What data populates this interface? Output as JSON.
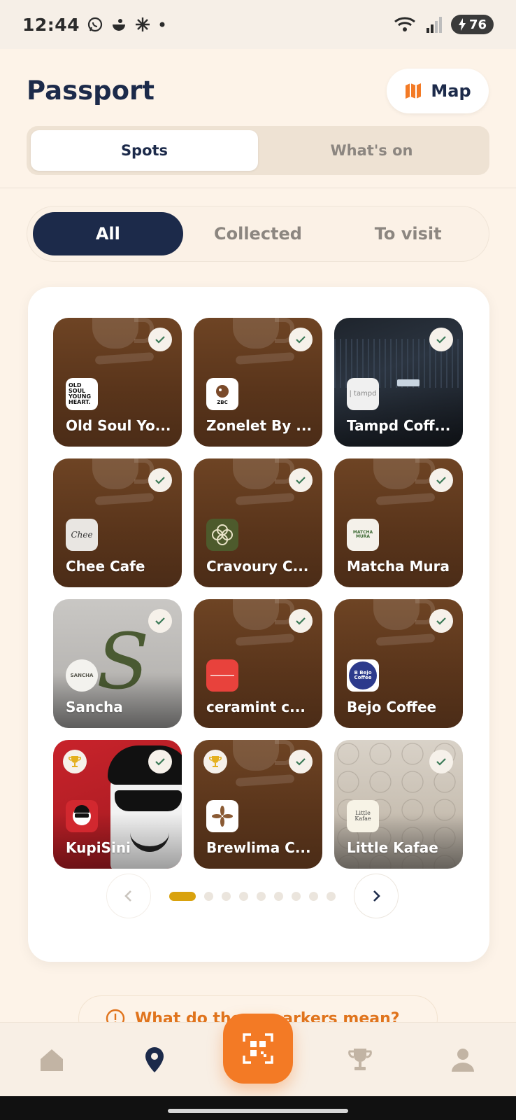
{
  "status_bar": {
    "time": "12:44",
    "battery": "76",
    "notification_icons": [
      "whatsapp-icon",
      "app-icon",
      "pinwheel-icon",
      "dot-icon"
    ]
  },
  "header": {
    "title": "Passport",
    "map_button_label": "Map"
  },
  "tabs": [
    {
      "label": "Spots",
      "active": true
    },
    {
      "label": "What's on",
      "active": false
    }
  ],
  "filters": [
    {
      "label": "All",
      "active": true
    },
    {
      "label": "Collected",
      "active": false
    },
    {
      "label": "To visit",
      "active": false
    }
  ],
  "spots": [
    {
      "name": "Old Soul Yo...",
      "logo_text": "OLD SOUL YOUNG HEART.",
      "collected": true,
      "trophy": false
    },
    {
      "name": "Zonelet By ...",
      "logo_text": "ZBC",
      "collected": true,
      "trophy": false
    },
    {
      "name": "Tampd Coff...",
      "logo_text": "| tampd",
      "collected": true,
      "trophy": false
    },
    {
      "name": "Chee Cafe",
      "logo_text": "Chee",
      "collected": true,
      "trophy": false
    },
    {
      "name": "Cravoury C...",
      "logo_text": "",
      "collected": true,
      "trophy": false
    },
    {
      "name": "Matcha Mura",
      "logo_text": "MATCHA MURA",
      "collected": true,
      "trophy": false
    },
    {
      "name": "Sancha",
      "logo_text": "SANCHA",
      "collected": true,
      "trophy": false
    },
    {
      "name": "ceramint c...",
      "logo_text": "",
      "collected": true,
      "trophy": false
    },
    {
      "name": "Bejo Coffee",
      "logo_text": "B Bejo Coffee",
      "collected": true,
      "trophy": false
    },
    {
      "name": "KupiSini",
      "logo_text": "",
      "collected": true,
      "trophy": true
    },
    {
      "name": "Brewlima C...",
      "logo_text": "",
      "collected": true,
      "trophy": true
    },
    {
      "name": "Little Kafae",
      "logo_text": "Little Kafae",
      "collected": true,
      "trophy": false
    }
  ],
  "pagination": {
    "total_pages": 9,
    "current_page": 1
  },
  "legend_prompt": "What do these markers mean?",
  "bottom_nav": [
    {
      "label": "home",
      "icon": "home-icon",
      "active": false
    },
    {
      "label": "passport",
      "icon": "location-pin-icon",
      "active": true
    },
    {
      "label": "scan",
      "icon": "qr-scan-icon",
      "active": false
    },
    {
      "label": "rewards",
      "icon": "trophy-icon",
      "active": false
    },
    {
      "label": "profile",
      "icon": "person-icon",
      "active": false
    }
  ],
  "colors": {
    "navy": "#1c2a4a",
    "orange": "#f37a25",
    "gold": "#d9a20e",
    "background": "#fdf3e8"
  }
}
